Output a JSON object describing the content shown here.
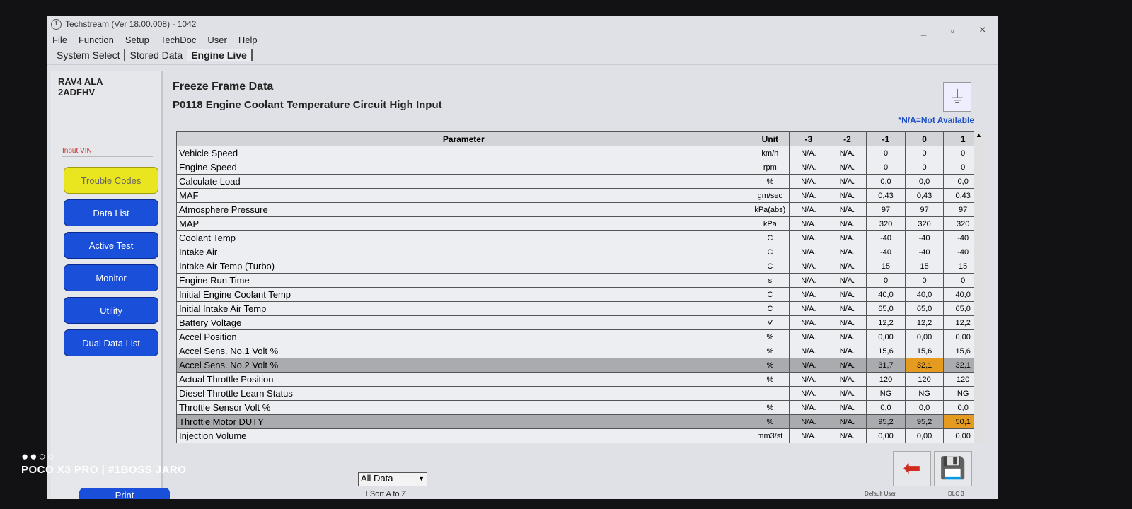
{
  "window": {
    "title": "Techstream (Ver 18.00.008) - 1042",
    "min": "_",
    "max": "▫",
    "close": "×"
  },
  "menu": [
    "File",
    "Function",
    "Setup",
    "TechDoc",
    "User",
    "Help"
  ],
  "tabs": [
    "System Select",
    "Stored Data",
    "Engine Live"
  ],
  "sidebar": {
    "vehicle1": "RAV4 ALA",
    "vehicle2": "2ADFHV",
    "input_vin": "Input VIN",
    "buttons": [
      "Trouble Codes",
      "Data List",
      "Active Test",
      "Monitor",
      "Utility",
      "Dual Data List"
    ],
    "print": "Print"
  },
  "main": {
    "title": "Freeze Frame Data",
    "dtc": "P0118 Engine Coolant Temperature Circuit High Input",
    "na_note": "*N/A=Not Available",
    "headers": [
      "Parameter",
      "Unit",
      "-3",
      "-2",
      "-1",
      "0",
      "1"
    ],
    "rows": [
      [
        "Vehicle Speed",
        "km/h",
        "N/A.",
        "N/A.",
        "0",
        "0",
        "0"
      ],
      [
        "Engine Speed",
        "rpm",
        "N/A.",
        "N/A.",
        "0",
        "0",
        "0"
      ],
      [
        "Calculate Load",
        "%",
        "N/A.",
        "N/A.",
        "0,0",
        "0,0",
        "0,0"
      ],
      [
        "MAF",
        "gm/sec",
        "N/A.",
        "N/A.",
        "0,43",
        "0,43",
        "0,43"
      ],
      [
        "Atmosphere Pressure",
        "kPa(abs)",
        "N/A.",
        "N/A.",
        "97",
        "97",
        "97"
      ],
      [
        "MAP",
        "kPa",
        "N/A.",
        "N/A.",
        "320",
        "320",
        "320"
      ],
      [
        "Coolant Temp",
        "C",
        "N/A.",
        "N/A.",
        "-40",
        "-40",
        "-40"
      ],
      [
        "Intake Air",
        "C",
        "N/A.",
        "N/A.",
        "-40",
        "-40",
        "-40"
      ],
      [
        "Intake Air Temp (Turbo)",
        "C",
        "N/A.",
        "N/A.",
        "15",
        "15",
        "15"
      ],
      [
        "Engine Run Time",
        "s",
        "N/A.",
        "N/A.",
        "0",
        "0",
        "0"
      ],
      [
        "Initial Engine Coolant Temp",
        "C",
        "N/A.",
        "N/A.",
        "40,0",
        "40,0",
        "40,0"
      ],
      [
        "Initial Intake Air Temp",
        "C",
        "N/A.",
        "N/A.",
        "65,0",
        "65,0",
        "65,0"
      ],
      [
        "Battery Voltage",
        "V",
        "N/A.",
        "N/A.",
        "12,2",
        "12,2",
        "12,2"
      ],
      [
        "Accel Position",
        "%",
        "N/A.",
        "N/A.",
        "0,00",
        "0,00",
        "0,00"
      ],
      [
        "Accel Sens. No.1 Volt %",
        "%",
        "N/A.",
        "N/A.",
        "15,6",
        "15,6",
        "15,6"
      ],
      [
        "Accel Sens. No.2 Volt %",
        "%",
        "N/A.",
        "N/A.",
        "31,7",
        "32,1",
        "32,1"
      ],
      [
        "Actual Throttle Position",
        "%",
        "N/A.",
        "N/A.",
        "120",
        "120",
        "120"
      ],
      [
        "Diesel Throttle Learn Status",
        "",
        "N/A.",
        "N/A.",
        "NG",
        "NG",
        "NG"
      ],
      [
        "Throttle Sensor Volt %",
        "%",
        "N/A.",
        "N/A.",
        "0,0",
        "0,0",
        "0,0"
      ],
      [
        "Throttle Motor DUTY",
        "%",
        "N/A.",
        "N/A.",
        "95,2",
        "95,2",
        "50,1"
      ],
      [
        "Injection Volume",
        "mm3/st",
        "N/A.",
        "N/A.",
        "0,00",
        "0,00",
        "0,00"
      ]
    ],
    "highlight_color": "#e59b1f",
    "filter": "All Data",
    "sort": "Sort A to Z"
  },
  "status": {
    "user": "Default User",
    "dlc": "DLC 3"
  },
  "watermark": {
    "dots": "●●○○",
    "text": "POCO X3 PRO | #1BOSS JARO"
  }
}
